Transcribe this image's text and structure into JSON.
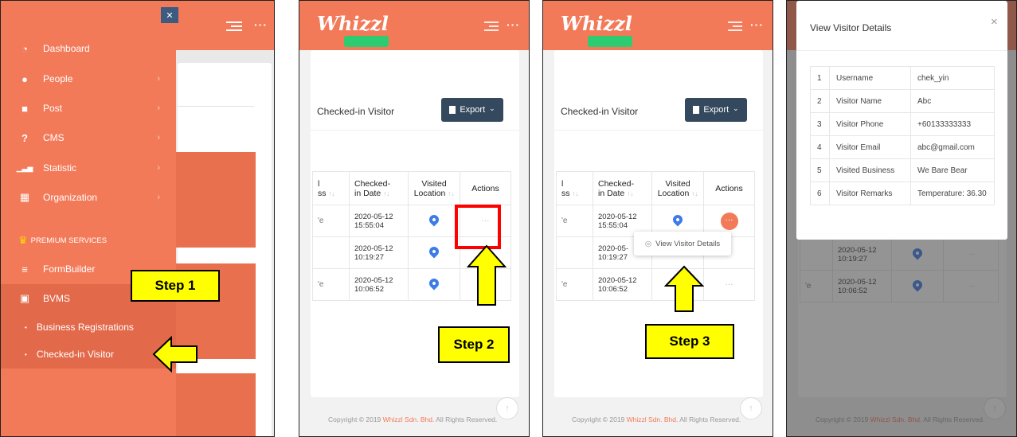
{
  "steps": [
    "Step 1",
    "Step 2",
    "Step 3"
  ],
  "app": {
    "logo": "Whizzl",
    "more": "···"
  },
  "sidebar": {
    "close": "✕",
    "items": [
      {
        "label": "Dashboard",
        "icon": "dashboard-icon",
        "glyph": "◔"
      },
      {
        "label": "People",
        "icon": "person-icon",
        "glyph": "●",
        "chevron": "›"
      },
      {
        "label": "Post",
        "icon": "chat-icon",
        "glyph": "■",
        "chevron": "›"
      },
      {
        "label": "CMS",
        "icon": "help-icon",
        "glyph": "?",
        "chevron": "›"
      },
      {
        "label": "Statistic",
        "icon": "chart-icon",
        "glyph": "▁▃▅",
        "chevron": "›"
      },
      {
        "label": "Organization",
        "icon": "building-icon",
        "glyph": "▦",
        "chevron": "›"
      }
    ],
    "premium": {
      "label": "PREMIUM SERVICES",
      "icon": "crown-icon",
      "glyph": "♛"
    },
    "premium_items": [
      {
        "label": "FormBuilder",
        "icon": "form-icon",
        "glyph": "≡"
      },
      {
        "label": "BVMS",
        "icon": "briefcase-icon",
        "glyph": "▣"
      }
    ],
    "sub_items": [
      {
        "label": "Business Registrations",
        "glyph": "•"
      },
      {
        "label": "Checked-in Visitor",
        "glyph": "•"
      }
    ]
  },
  "checked_in": {
    "title": "Checked-in Visitor",
    "export_label": "Export",
    "export_icon": "export-icon",
    "chevron": "⌄",
    "sort_glyph": "↑↓",
    "columns": {
      "business_partial_1": "l",
      "business_partial_2": "ss",
      "date_1": "Checked-",
      "date_2": "in Date",
      "location_1": "Visited",
      "location_2": "Location",
      "actions": "Actions"
    },
    "rows": [
      {
        "business": "'e",
        "date": "2020-05-12",
        "time": "15:55:04"
      },
      {
        "business": "",
        "date": "2020-05-12",
        "time": "10:19:27"
      },
      {
        "business": "'e",
        "date": "2020-05-12",
        "time": "10:06:52"
      }
    ],
    "action_dots": "···",
    "date_partial": "2020-05-"
  },
  "dropdown": {
    "item_label": "View Visitor Details",
    "icon": "eye-icon",
    "glyph": "◎"
  },
  "footer": {
    "prefix": "Copyright © 2019 ",
    "brand": "Whizzl Sdn. Bhd.",
    "suffix": " All Rights Reserved.",
    "scroll_top": "↑"
  },
  "modal": {
    "title": "View Visitor Details",
    "close": "×",
    "rows": [
      {
        "no": "1",
        "field": "Username",
        "value": "chek_yin"
      },
      {
        "no": "2",
        "field": "Visitor Name",
        "value": "Abc"
      },
      {
        "no": "3",
        "field": "Visitor Phone",
        "value": "+60133333333"
      },
      {
        "no": "4",
        "field": "Visitor Email",
        "value": "abc@gmail.com"
      },
      {
        "no": "5",
        "field": "Visited Business",
        "value": "We Bare Bear"
      },
      {
        "no": "6",
        "field": "Visitor Remarks",
        "value": "Temperature: 36.30"
      }
    ]
  },
  "colors": {
    "accent": "#f37a59",
    "export": "#34495e",
    "pin": "#3d7be8",
    "highlight": "#ff0000",
    "step": "#ffff00"
  }
}
